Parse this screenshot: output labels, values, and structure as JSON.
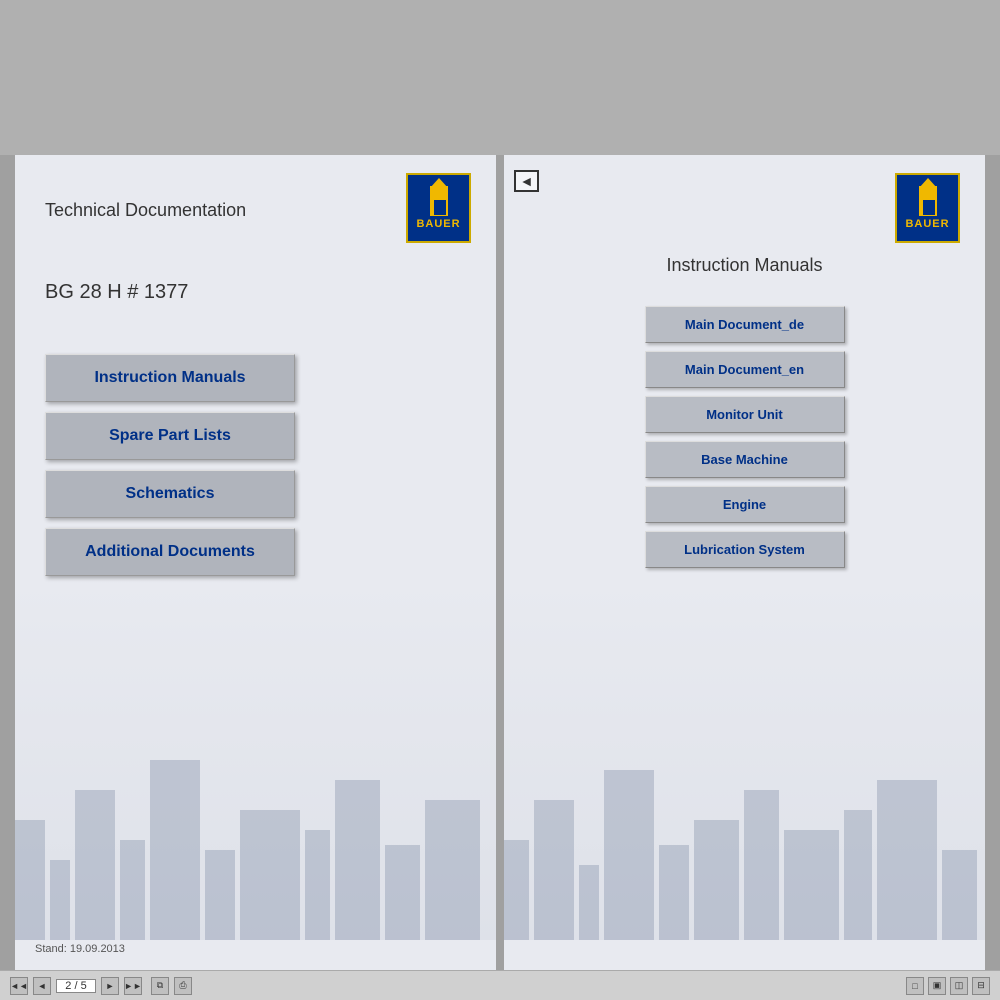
{
  "app": {
    "background_color": "#a0a8b0"
  },
  "left_page": {
    "title": "Technical Documentation",
    "machine_id": "BG 28 H # 1377",
    "stand_text": "Stand: 19.09.2013",
    "logo_text": "BAUER",
    "buttons": [
      {
        "id": "instruction-manuals",
        "label": "Instruction Manuals"
      },
      {
        "id": "spare-part-lists",
        "label": "Spare Part Lists"
      },
      {
        "id": "schematics",
        "label": "Schematics"
      },
      {
        "id": "additional-documents",
        "label": "Additional Documents"
      }
    ]
  },
  "right_page": {
    "title": "Instruction Manuals",
    "logo_text": "BAUER",
    "back_icon": "◄",
    "buttons": [
      {
        "id": "main-document-de",
        "label": "Main Document_de"
      },
      {
        "id": "main-document-en",
        "label": "Main Document_en"
      },
      {
        "id": "monitor-unit",
        "label": "Monitor Unit"
      },
      {
        "id": "base-machine",
        "label": "Base Machine"
      },
      {
        "id": "engine",
        "label": "Engine"
      },
      {
        "id": "lubrication-system",
        "label": "Lubrication System"
      }
    ]
  },
  "toolbar": {
    "page_current": "2",
    "page_total": "5",
    "page_display": "2 / 5",
    "first_btn": "◄◄",
    "prev_btn": "◄",
    "next_btn": "►",
    "last_btn": "►►",
    "icons": [
      "⧉",
      "🖨"
    ]
  }
}
